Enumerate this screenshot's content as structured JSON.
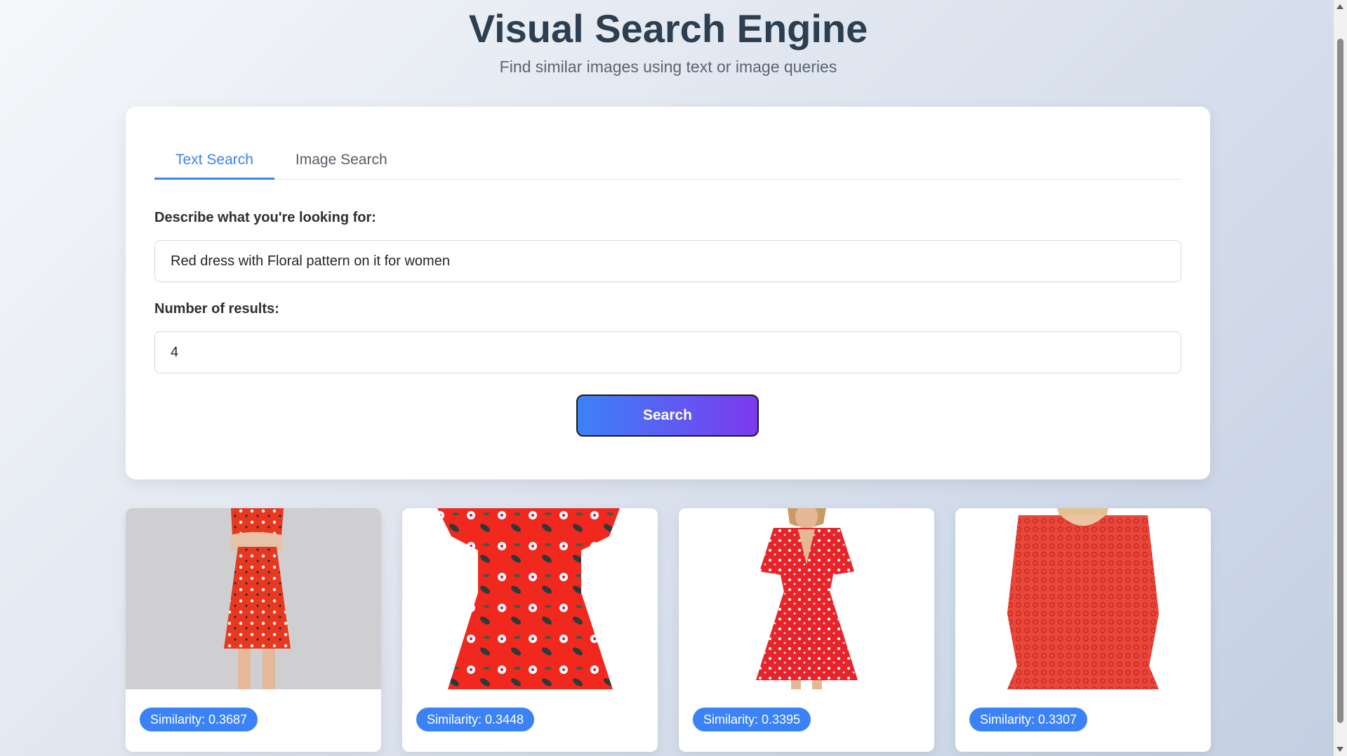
{
  "header": {
    "title": "Visual Search Engine",
    "subtitle": "Find similar images using text or image queries"
  },
  "tabs": [
    {
      "label": "Text Search",
      "active": true
    },
    {
      "label": "Image Search",
      "active": false
    }
  ],
  "form": {
    "query_label": "Describe what you're looking for:",
    "query_value": "Red dress with Floral pattern on it for women",
    "count_label": "Number of results:",
    "count_value": "4",
    "search_label": "Search"
  },
  "results": [
    {
      "similarity": "Similarity: 0.3687",
      "image": "red-floral-dress-photo"
    },
    {
      "similarity": "Similarity: 0.3448",
      "image": "red-floral-dress-photo"
    },
    {
      "similarity": "Similarity: 0.3395",
      "image": "red-floral-dress-photo"
    },
    {
      "similarity": "Similarity: 0.3307",
      "image": "red-lace-dress-photo"
    }
  ],
  "colors": {
    "accent": "#3b82f6",
    "gradient_end": "#7c3aed",
    "dress_red": "#e8302a"
  }
}
